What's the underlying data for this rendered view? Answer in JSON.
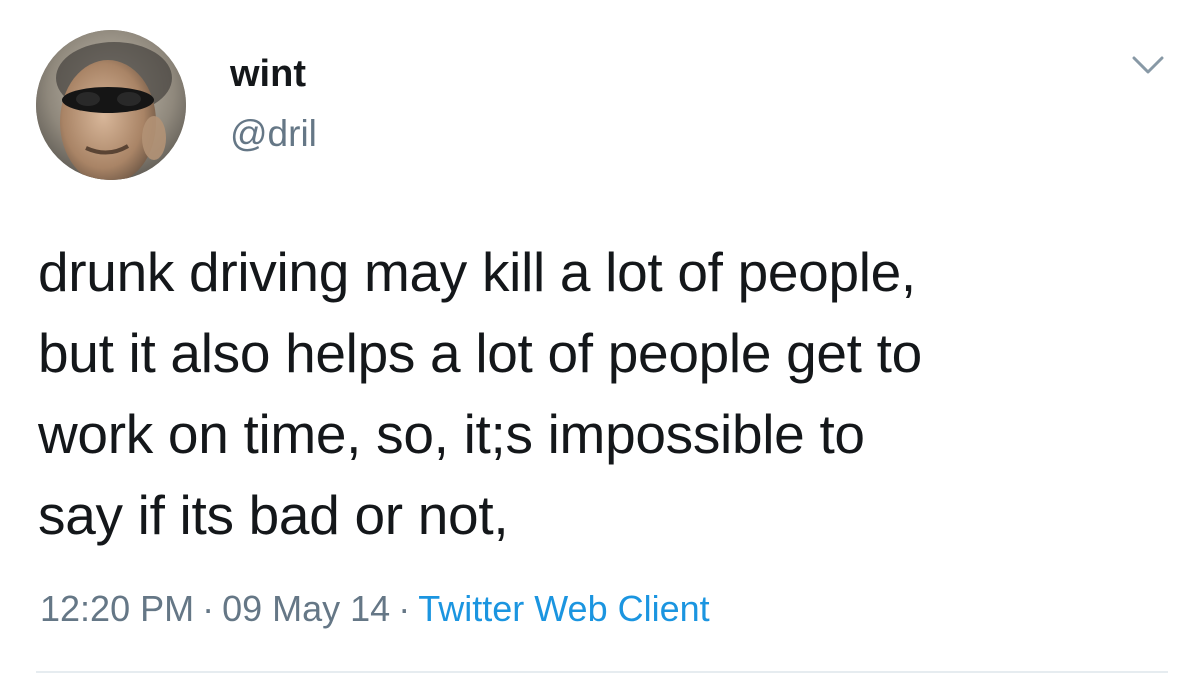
{
  "tweet": {
    "display_name": "wint",
    "handle": "@dril",
    "text": "drunk driving may kill a lot of people,\nbut it also helps a lot of people get to\nwork on time, so, it;s impossible to\nsay if its bad or not,",
    "time": "12:20 PM",
    "date": "09 May 14",
    "client": "Twitter Web Client",
    "separator": "·"
  },
  "icons": {
    "more": "chevron-down-icon"
  },
  "colors": {
    "text": "#14171a",
    "secondary": "#657786",
    "link": "#1b95e0",
    "divider": "#e6ecf0"
  }
}
